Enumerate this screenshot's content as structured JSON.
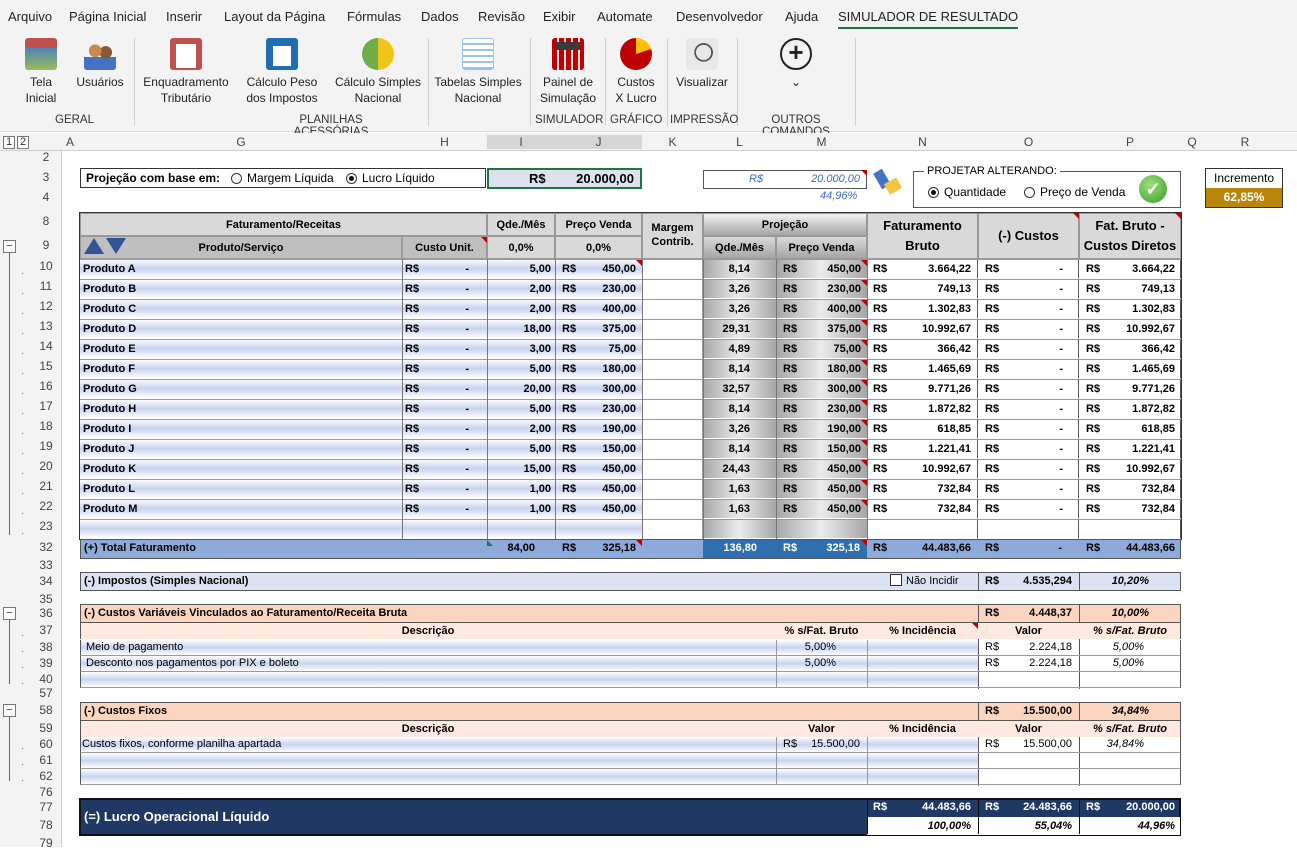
{
  "menu": [
    "Arquivo",
    "Página Inicial",
    "Inserir",
    "Layout da Página",
    "Fórmulas",
    "Dados",
    "Revisão",
    "Exibir",
    "Automate",
    "Desenvolvedor",
    "Ajuda",
    "SIMULADOR DE RESULTADO"
  ],
  "ribbon": {
    "buttons": [
      {
        "l1": "Tela",
        "l2": "Inicial"
      },
      {
        "l1": "Usuários",
        "l2": ""
      },
      {
        "l1": "Enquadramento",
        "l2": "Tributário"
      },
      {
        "l1": "Cálculo Peso",
        "l2": "dos Impostos"
      },
      {
        "l1": "Cálculo Simples",
        "l2": "Nacional"
      },
      {
        "l1": "Tabelas Simples",
        "l2": "Nacional"
      },
      {
        "l1": "Painel de",
        "l2": "Simulação"
      },
      {
        "l1": "Custos",
        "l2": "X Lucro"
      },
      {
        "l1": "Visualizar",
        "l2": ""
      }
    ],
    "groups": [
      "GERAL",
      "PLANILHAS ACESSÓRIAS",
      "SIMULADOR",
      "GRÁFICO",
      "IMPRESSÃO",
      "OUTROS COMANDOS"
    ],
    "more": "⌄"
  },
  "outline_levels": [
    "1",
    "2"
  ],
  "columns": [
    "A",
    "G",
    "H",
    "I",
    "J",
    "K",
    "L",
    "M",
    "N",
    "O",
    "P",
    "Q",
    "R"
  ],
  "rows": [
    "2",
    "3",
    "4",
    "8",
    "9",
    "10",
    "11",
    "12",
    "13",
    "14",
    "15",
    "16",
    "17",
    "18",
    "19",
    "20",
    "21",
    "22",
    "23",
    "32",
    "33",
    "34",
    "35",
    "36",
    "37",
    "38",
    "39",
    "40",
    "57",
    "58",
    "59",
    "60",
    "61",
    "62",
    "76",
    "77",
    "78",
    "79"
  ],
  "projecao": {
    "label": "Projeção com base em:",
    "opt1": "Margem Líquida",
    "opt2": "Lucro Líquido",
    "selected": "Lucro Líquido",
    "currency": "R$",
    "value": "20.000,00"
  },
  "target": {
    "currency": "R$",
    "value": "20.000,00",
    "pct": "44,96%"
  },
  "projetar": {
    "label": "PROJETAR ALTERANDO:",
    "opt1": "Quantidade",
    "opt2": "Preço de Venda",
    "selected": "Quantidade"
  },
  "incremento": {
    "label": "Incremento",
    "value": "62,85%"
  },
  "headers": {
    "fat_receitas": "Faturamento/Receitas",
    "qde_mes": "Qde./Mês",
    "preco_venda": "Preço Venda",
    "margem": "Margem",
    "contrib": "Contrib.",
    "projecao": "Projeção",
    "produto": "Produto/Serviço",
    "custo_unit": "Custo Unit.",
    "pct_i": "0,0%",
    "pct_j": "0,0%",
    "qde_mes2": "Qde./Mês",
    "preco_venda2": "Preço Venda",
    "fat_bruto1": "Faturamento",
    "fat_bruto2": "Bruto",
    "custos": "(-) Custos",
    "fbcd1": "Fat. Bruto -",
    "fbcd2": "Custos Diretos"
  },
  "products": [
    {
      "name": "Produto A",
      "qty": "5,00",
      "price": "450,00",
      "pqty": "8,14",
      "pprice": "450,00",
      "fat": "3.664,22",
      "fbcd": "3.664,22"
    },
    {
      "name": "Produto B",
      "qty": "2,00",
      "price": "230,00",
      "pqty": "3,26",
      "pprice": "230,00",
      "fat": "749,13",
      "fbcd": "749,13"
    },
    {
      "name": "Produto C",
      "qty": "2,00",
      "price": "400,00",
      "pqty": "3,26",
      "pprice": "400,00",
      "fat": "1.302,83",
      "fbcd": "1.302,83"
    },
    {
      "name": "Produto D",
      "qty": "18,00",
      "price": "375,00",
      "pqty": "29,31",
      "pprice": "375,00",
      "fat": "10.992,67",
      "fbcd": "10.992,67"
    },
    {
      "name": "Produto E",
      "qty": "3,00",
      "price": "75,00",
      "pqty": "4,89",
      "pprice": "75,00",
      "fat": "366,42",
      "fbcd": "366,42"
    },
    {
      "name": "Produto F",
      "qty": "5,00",
      "price": "180,00",
      "pqty": "8,14",
      "pprice": "180,00",
      "fat": "1.465,69",
      "fbcd": "1.465,69"
    },
    {
      "name": "Produto G",
      "qty": "20,00",
      "price": "300,00",
      "pqty": "32,57",
      "pprice": "300,00",
      "fat": "9.771,26",
      "fbcd": "9.771,26"
    },
    {
      "name": "Produto H",
      "qty": "5,00",
      "price": "230,00",
      "pqty": "8,14",
      "pprice": "230,00",
      "fat": "1.872,82",
      "fbcd": "1.872,82"
    },
    {
      "name": "Produto I",
      "qty": "2,00",
      "price": "190,00",
      "pqty": "3,26",
      "pprice": "190,00",
      "fat": "618,85",
      "fbcd": "618,85"
    },
    {
      "name": "Produto J",
      "qty": "5,00",
      "price": "150,00",
      "pqty": "8,14",
      "pprice": "150,00",
      "fat": "1.221,41",
      "fbcd": "1.221,41"
    },
    {
      "name": "Produto K",
      "qty": "15,00",
      "price": "450,00",
      "pqty": "24,43",
      "pprice": "450,00",
      "fat": "10.992,67",
      "fbcd": "10.992,67"
    },
    {
      "name": "Produto L",
      "qty": "1,00",
      "price": "450,00",
      "pqty": "1,63",
      "pprice": "450,00",
      "fat": "732,84",
      "fbcd": "732,84"
    },
    {
      "name": "Produto M",
      "qty": "1,00",
      "price": "450,00",
      "pqty": "1,63",
      "pprice": "450,00",
      "fat": "732,84",
      "fbcd": "732,84"
    }
  ],
  "cur": "R$",
  "dash": "-",
  "total": {
    "label": "(+) Total Faturamento",
    "qty": "84,00",
    "price": "325,18",
    "pqty": "136,80",
    "pprice": "325,18",
    "fat": "44.483,66",
    "custos": "-",
    "fbcd": "44.483,66"
  },
  "impostos": {
    "label": "(-) Impostos (Simples Nacional)",
    "nao_incidir": "Não Incidir",
    "value": "4.535,294",
    "pct": "10,20%"
  },
  "cv": {
    "label": "(-) Custos Variáveis Vinculados ao Faturamento/Receita Bruta",
    "value": "4.448,37",
    "pct": "10,00%",
    "h_desc": "Descrição",
    "h_pct": "% s/Fat. Bruto",
    "h_inc": "% Incidência",
    "h_valor": "Valor",
    "h_pct2": "% s/Fat. Bruto",
    "items": [
      {
        "desc": "Meio de pagamento",
        "pct": "5,00%",
        "valor": "2.224,18",
        "pct2": "5,00%"
      },
      {
        "desc": "Desconto nos pagamentos por PIX e boleto",
        "pct": "5,00%",
        "valor": "2.224,18",
        "pct2": "5,00%"
      }
    ]
  },
  "cf": {
    "label": "(-) Custos Fixos",
    "value": "15.500,00",
    "pct": "34,84%",
    "h_desc": "Descrição",
    "h_valor": "Valor",
    "h_inc": "% Incidência",
    "h_valor2": "Valor",
    "h_pct2": "% s/Fat. Bruto",
    "items": [
      {
        "desc": "Custos fixos, conforme planilha apartada",
        "valor": "15.500,00",
        "valor2": "15.500,00",
        "pct2": "34,84%"
      }
    ]
  },
  "lucro": {
    "label": "(=) Lucro Operacional Líquido",
    "fat": "44.483,66",
    "custos": "24.483,66",
    "lucro": "20.000,00",
    "p1": "100,00%",
    "p2": "55,04%",
    "p3": "44,96%"
  }
}
